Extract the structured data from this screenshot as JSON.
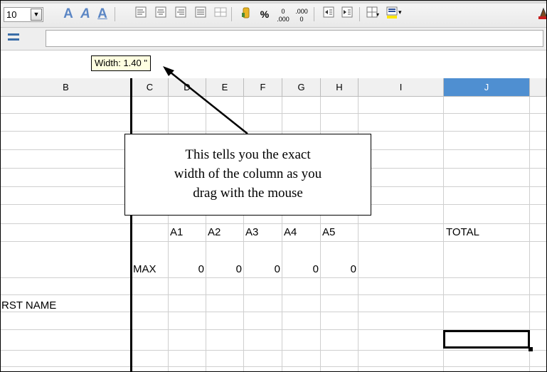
{
  "toolbar": {
    "font_size_value": "10",
    "buttons": [
      {
        "icon": "font-outline-icon",
        "glyph": "A"
      },
      {
        "icon": "font-italic-shadow-icon",
        "glyph": "A"
      },
      {
        "icon": "font-underline-icon",
        "glyph": "A"
      },
      {
        "icon": "align-left-icon",
        "glyph": "≡"
      },
      {
        "icon": "align-center-icon",
        "glyph": "≡"
      },
      {
        "icon": "align-right-icon",
        "glyph": "≡"
      },
      {
        "icon": "align-justify-icon",
        "glyph": "≡"
      },
      {
        "icon": "merge-cells-icon",
        "glyph": "⊞"
      },
      {
        "icon": "currency-format-icon",
        "glyph": "$"
      },
      {
        "icon": "percent-format-icon",
        "glyph": "%"
      },
      {
        "icon": "add-decimal-icon",
        "glyph": "0"
      },
      {
        "icon": "remove-decimal-icon",
        "glyph": "0"
      },
      {
        "icon": "decrease-indent-icon",
        "glyph": "⇤"
      },
      {
        "icon": "increase-indent-icon",
        "glyph": "⇥"
      },
      {
        "icon": "borders-icon",
        "glyph": "⊞"
      },
      {
        "icon": "background-color-icon",
        "glyph": "▤"
      }
    ]
  },
  "formula_bar": {
    "tooltip": "Width: 1.40 \""
  },
  "columns": [
    "B",
    "C",
    "D",
    "E",
    "F",
    "G",
    "H",
    "I",
    "J"
  ],
  "selected_column": "J",
  "cells": {
    "a1": "A1",
    "a2": "A2",
    "a3": "A3",
    "a4": "A4",
    "a5": "A5",
    "total": "TOTAL",
    "max": "MAX",
    "max_values": [
      "0",
      "0",
      "0",
      "0",
      "0"
    ],
    "first_name": "RST NAME"
  },
  "callout": {
    "line1": "This tells you the exact",
    "line2": "width of the column as you",
    "line3": "drag with the mouse"
  }
}
